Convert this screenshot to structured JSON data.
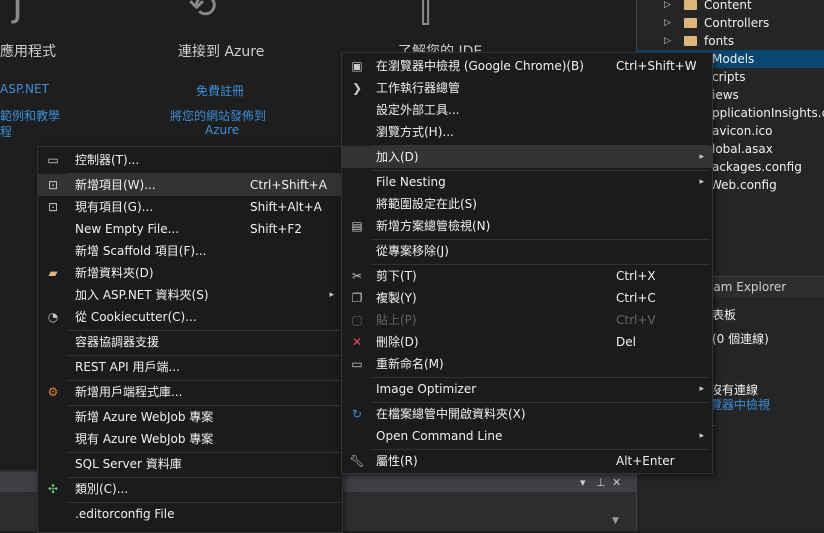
{
  "start_page": {
    "col1_heading": "應用程式",
    "col1_links": [
      "ASP.NET",
      "範例和教學",
      "程"
    ],
    "col2_heading": "連接到 Azure",
    "col2_links": [
      "免費註冊",
      "將您的網站發佈到",
      "Azure"
    ],
    "col3_heading": "了解您的 IDE"
  },
  "solution_explorer": {
    "folders": [
      {
        "label": "Content"
      },
      {
        "label": "Controllers"
      },
      {
        "label": "fonts"
      }
    ],
    "selected_partial": "Models",
    "files_partial": [
      "cripts",
      "iews",
      "pplicationInsights.co",
      "avicon.ico",
      "lobal.asax",
      "ackages.config",
      "Web.config"
    ]
  },
  "team_explorer": {
    "header": "eam Explorer",
    "line1": "表板",
    "line2": "(0 個連線)",
    "line3": "沒有連線",
    "link": "覽器中檢視"
  },
  "left_menu": {
    "items": [
      {
        "label": "控制器(T)...",
        "shortcut": "",
        "icon": "controller-icon"
      },
      {
        "label": "新增項目(W)...",
        "shortcut": "Ctrl+Shift+A",
        "icon": "new-item-icon"
      },
      {
        "label": "現有項目(G)...",
        "shortcut": "Shift+Alt+A",
        "icon": "existing-item-icon"
      },
      {
        "label": "New Empty File...",
        "shortcut": "Shift+F2",
        "icon": ""
      },
      {
        "label": "新增 Scaffold 項目(F)...",
        "shortcut": "",
        "icon": ""
      },
      {
        "label": "新增資料夾(D)",
        "shortcut": "",
        "icon": "new-folder-icon"
      },
      {
        "label": "加入 ASP.NET 資料夾(S)",
        "shortcut": "",
        "icon": ""
      },
      {
        "label": "從 Cookiecutter(C)...",
        "shortcut": "",
        "icon": "cookiecutter-icon"
      },
      {
        "label": "容器協調器支援",
        "shortcut": "",
        "icon": ""
      },
      {
        "label": "REST API 用戶端...",
        "shortcut": "",
        "icon": ""
      },
      {
        "label": "新增用戶端程式庫...",
        "shortcut": "",
        "icon": "client-library-icon"
      },
      {
        "label": "新增 Azure WebJob 專案",
        "shortcut": "",
        "icon": ""
      },
      {
        "label": "現有 Azure WebJob 專案",
        "shortcut": "",
        "icon": ""
      },
      {
        "label": "SQL Server 資料庫",
        "shortcut": "",
        "icon": ""
      },
      {
        "label": "類別(C)...",
        "shortcut": "",
        "icon": "class-icon"
      },
      {
        "label": ".editorconfig File",
        "shortcut": "",
        "icon": ""
      }
    ]
  },
  "right_menu": {
    "items": [
      {
        "label": "在瀏覽器中檢視 (Google Chrome)(B)",
        "shortcut": "Ctrl+Shift+W",
        "icon": "browser-view-icon"
      },
      {
        "label": "工作執行器總管",
        "shortcut": "",
        "icon": "task-runner-icon"
      },
      {
        "label": "設定外部工具...",
        "shortcut": "",
        "icon": ""
      },
      {
        "label": "瀏覽方式(H)...",
        "shortcut": "",
        "icon": ""
      },
      {
        "label": "加入(D)",
        "shortcut": "",
        "icon": ""
      },
      {
        "label": "File Nesting",
        "shortcut": "",
        "icon": ""
      },
      {
        "label": "將範圍設定在此(S)",
        "shortcut": "",
        "icon": ""
      },
      {
        "label": "新增方案總管檢視(N)",
        "shortcut": "",
        "icon": "new-view-icon"
      },
      {
        "label": "從專案移除(J)",
        "shortcut": "",
        "icon": ""
      },
      {
        "label": "剪下(T)",
        "shortcut": "Ctrl+X",
        "icon": "cut-icon"
      },
      {
        "label": "複製(Y)",
        "shortcut": "Ctrl+C",
        "icon": "copy-icon"
      },
      {
        "label": "貼上(P)",
        "shortcut": "Ctrl+V",
        "icon": "paste-icon"
      },
      {
        "label": "刪除(D)",
        "shortcut": "Del",
        "icon": "delete-icon"
      },
      {
        "label": "重新命名(M)",
        "shortcut": "",
        "icon": "rename-icon"
      },
      {
        "label": "Image Optimizer",
        "shortcut": "",
        "icon": ""
      },
      {
        "label": "在檔案總管中開啟資料夾(X)",
        "shortcut": "",
        "icon": "open-folder-icon"
      },
      {
        "label": "Open Command Line",
        "shortcut": "",
        "icon": ""
      },
      {
        "label": "屬性(R)",
        "shortcut": "Alt+Enter",
        "icon": "wrench-icon"
      }
    ]
  }
}
